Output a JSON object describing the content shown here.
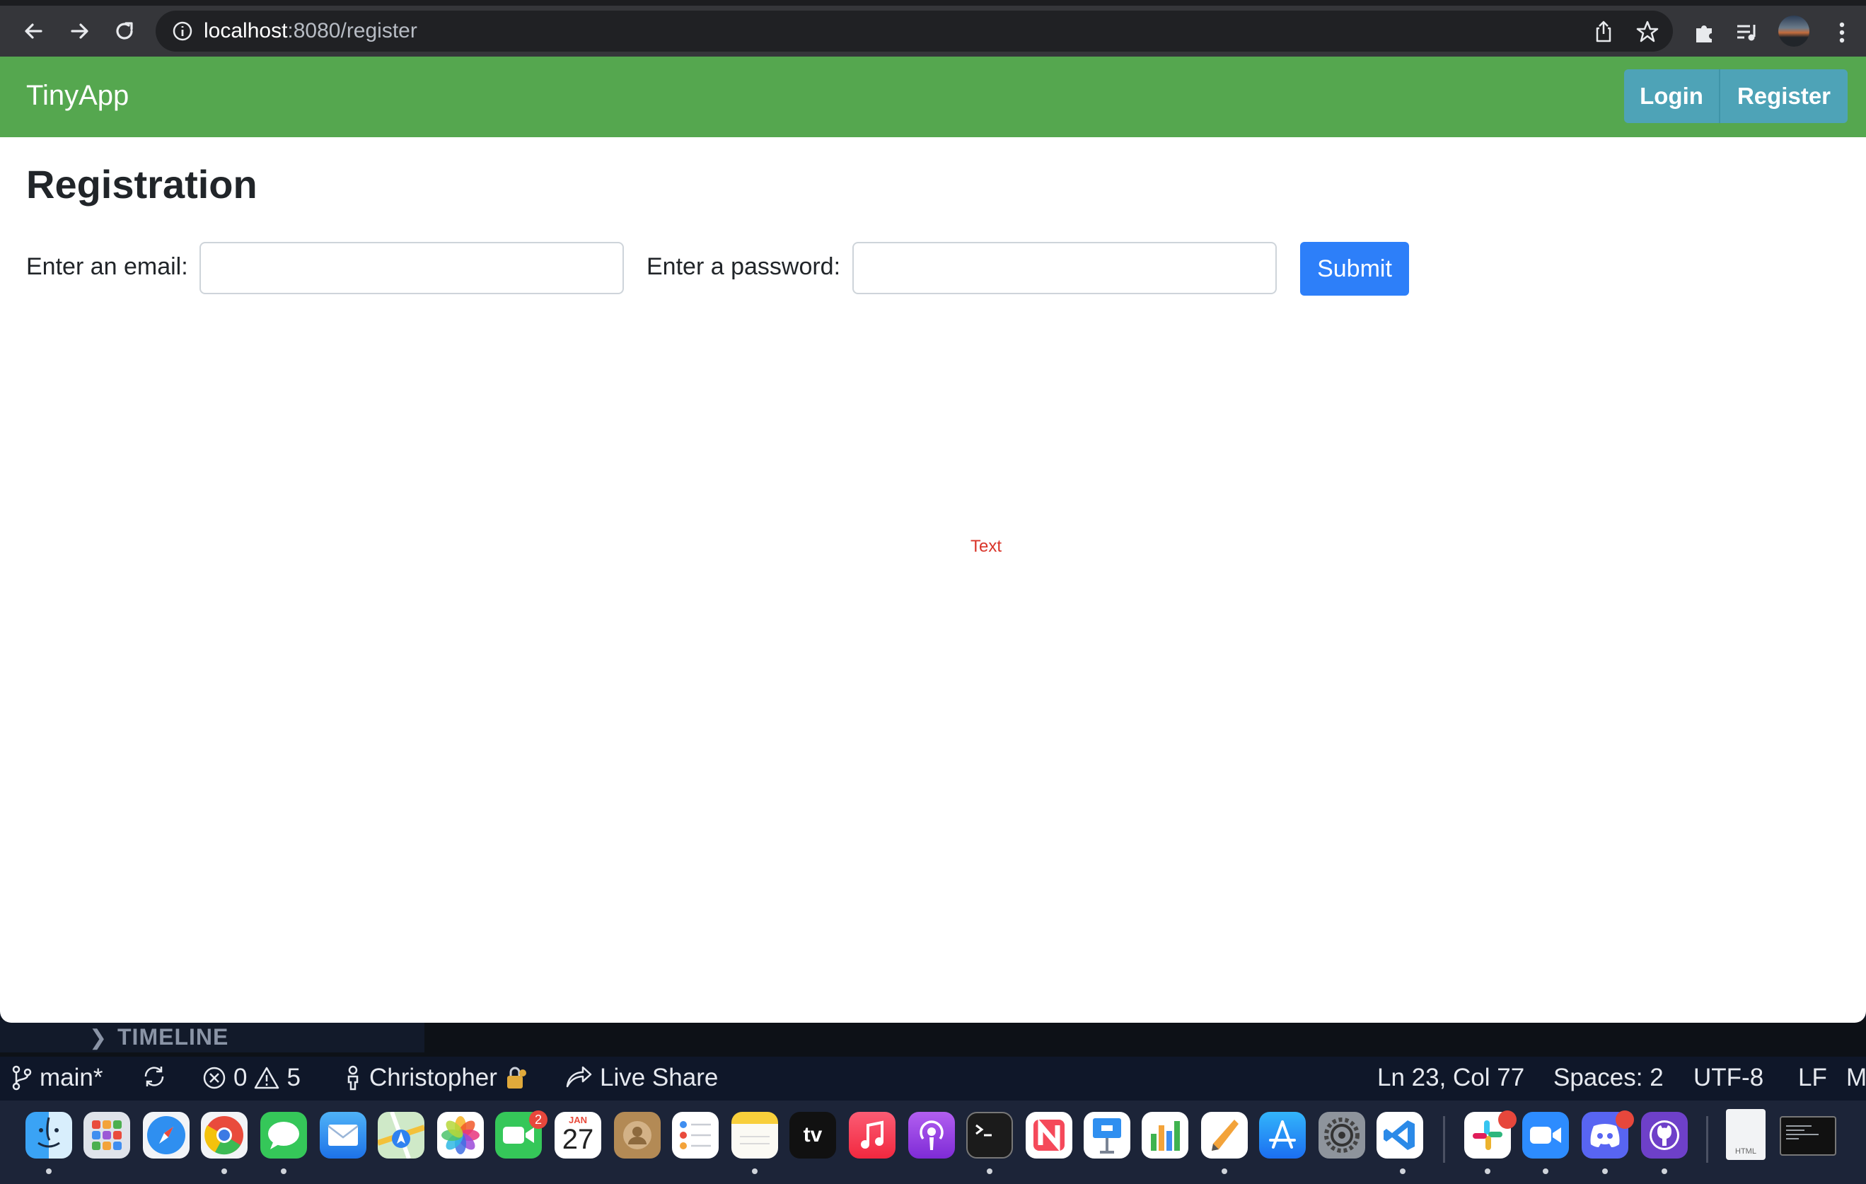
{
  "browser": {
    "url_host": "localhost",
    "url_path": ":8080/register"
  },
  "app": {
    "brand": "TinyApp",
    "nav": {
      "login": "Login",
      "register": "Register"
    }
  },
  "page": {
    "title": "Registration",
    "email_label": "Enter an email:",
    "email_value": "",
    "password_label": "Enter a password:",
    "password_value": "",
    "submit_label": "Submit",
    "text_label": "Text"
  },
  "vscode": {
    "timeline_label": "TIMELINE",
    "branch": "main*",
    "errors": "0",
    "warnings": "5",
    "user": "Christopher",
    "live_share": "Live Share",
    "cursor": "Ln 23, Col 77",
    "spaces": "Spaces: 2",
    "encoding": "UTF-8",
    "eol": "LF",
    "language_partial": "M"
  },
  "dock": {
    "facetime_badge": "2",
    "calendar_month": "JAN",
    "calendar_day": "27",
    "appletv_label": "tv",
    "html_file_label": "HTML",
    "apps": [
      "finder-icon",
      "launchpad-icon",
      "safari-icon",
      "chrome-icon",
      "messages-icon",
      "mail-icon",
      "maps-icon",
      "photos-icon",
      "facetime-icon",
      "calendar-icon",
      "contacts-icon",
      "reminders-icon",
      "notes-icon",
      "appletv-icon",
      "music-icon",
      "podcasts-icon",
      "terminal-icon",
      "news-icon",
      "keynote-icon",
      "numbers-icon",
      "pages-icon",
      "appstore-icon",
      "system-preferences-icon",
      "vscode-icon",
      "slack-icon",
      "zoom-icon",
      "discord-icon",
      "github-desktop-icon",
      "html-file-icon",
      "terminal-window-icon"
    ]
  },
  "colors": {
    "navbar": "#55a74f",
    "nav_button": "#4ea3b7",
    "submit": "#2d7ff9",
    "red_text": "#d9352a",
    "chrome_toolbar": "#35363a"
  }
}
